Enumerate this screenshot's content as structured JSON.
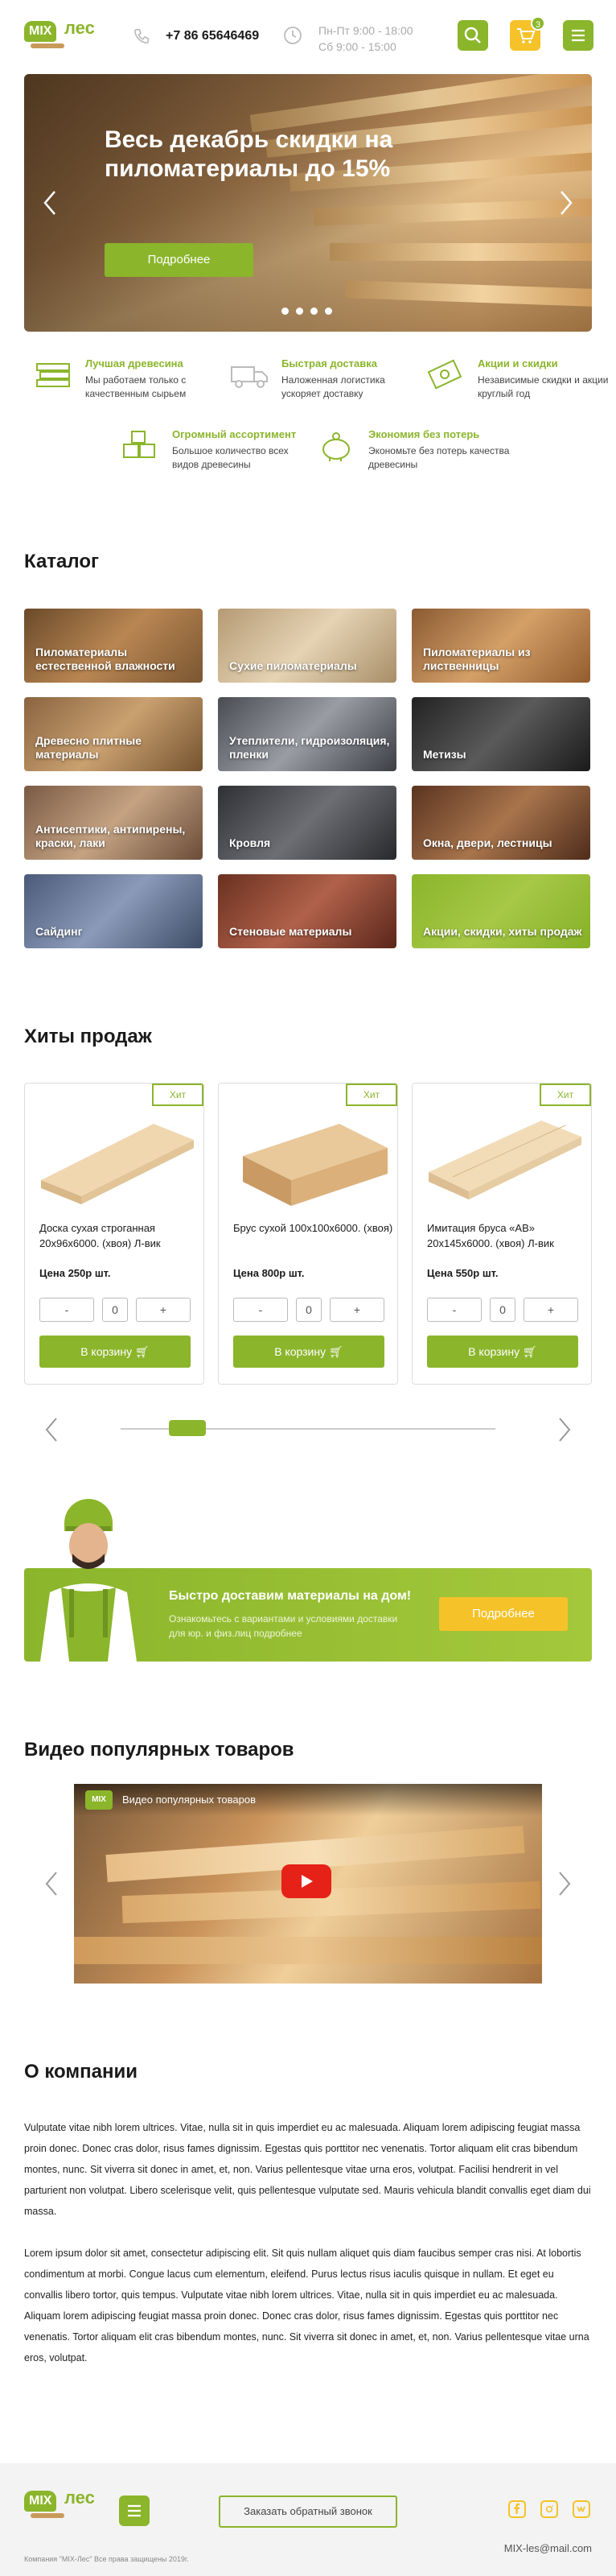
{
  "header": {
    "logo_mix": "MIX",
    "logo_les": "лес",
    "phone": "+7 86 65646469",
    "hours_line1": "Пн-Пт 9:00 - 18:00",
    "hours_line2": "Сб 9:00 - 15:00",
    "cart_count": "3"
  },
  "hero": {
    "title": "Весь декабрь скидки на пиломатериалы до 15%",
    "button": "Подробнее"
  },
  "features": [
    {
      "title": "Лучшая древесина",
      "desc": "Мы работаем только с качественным сырьем",
      "icon": "wood-icon"
    },
    {
      "title": "Быстрая доставка",
      "desc": "Наложенная логистика ускоряет доставку",
      "icon": "truck-icon"
    },
    {
      "title": "Акции и скидки",
      "desc": "Независимые скидки и акции круглый год",
      "icon": "money-icon"
    },
    {
      "title": "Огромный ассортимент",
      "desc": "Большое количество всех видов древесины",
      "icon": "boxes-icon"
    },
    {
      "title": "Экономия без потерь",
      "desc": "Экономьте без потерь качества древесины",
      "icon": "piggy-icon"
    }
  ],
  "catalog": {
    "title": "Каталог",
    "items": [
      "Пиломатериалы естественной влажности",
      "Сухие пиломатериалы",
      "Пиломатериалы из лиственницы",
      "Древесно плитные материалы",
      "Утеплители, гидроизоляция, пленки",
      "Метизы",
      "Антисептики, антипирены, краски, лаки",
      "Кровля",
      "Окна, двери, лестницы",
      "Сайдинг",
      "Стеновые материалы",
      "Акции, скидки, хиты продаж"
    ]
  },
  "hits": {
    "title": "Хиты продаж",
    "badge": "Хит",
    "cart_button": "В корзину",
    "products": [
      {
        "name": "Доска сухая строганная 20х96х6000. (хвоя) Л-вик",
        "price": "Цена 250р шт.",
        "qty": "0"
      },
      {
        "name": "Брус сухой 100х100х6000. (хвоя)",
        "price": "Цена 800р шт.",
        "qty": "0"
      },
      {
        "name": "Имитация бруса «АВ» 20х145х6000. (хвоя) Л-вик",
        "price": "Цена 550р шт.",
        "qty": "0"
      }
    ],
    "minus": "-",
    "plus": "+"
  },
  "delivery": {
    "title": "Быстро доставим материалы на дом!",
    "desc": "Ознакомьтесь с вариантами и условиями доставки для юр. и физ.лиц подробнее",
    "button": "Подробнее"
  },
  "video": {
    "section_title": "Видео популярных товаров",
    "player_title": "Видео популярных товаров",
    "channel_mix": "MIX"
  },
  "about": {
    "title": "О компании",
    "p1": "Vulputate vitae nibh lorem ultrices. Vitae, nulla sit in quis imperdiet eu ac malesuada. Aliquam lorem adipiscing feugiat massa proin donec. Donec cras dolor, risus fames dignissim. Egestas quis porttitor nec venenatis. Tortor aliquam elit cras bibendum montes, nunc. Sit viverra sit donec in amet, et, non. Varius pellentesque vitae urna eros, volutpat. Facilisi hendrerit in vel parturient non volutpat. Libero scelerisque velit, quis pellentesque vulputate sed. Mauris vehicula blandit convallis eget diam dui massa.",
    "p2": "Lorem ipsum dolor sit amet, consectetur adipiscing elit. Sit quis nullam aliquet quis diam faucibus semper cras nisi. At lobortis condimentum at morbi. Congue lacus cum elementum, eleifend. Purus lectus risus iaculis quisque in nullam. Et eget eu convallis libero tortor, quis tempus. Vulputate vitae nibh lorem ultrices. Vitae, nulla sit in quis imperdiet eu ac malesuada. Aliquam lorem adipiscing feugiat massa proin donec. Donec cras dolor, risus fames dignissim. Egestas quis porttitor nec venenatis. Tortor aliquam elit cras bibendum montes, nunc. Sit viverra sit donec in amet, et, non. Varius pellentesque vitae urna eros, volutpat."
  },
  "footer": {
    "callback": "Заказать обратный звонок",
    "copyright": "Компания \"MIX-Лес\" Все права защищены 2019г.",
    "email": "MIX-les@mail.com"
  },
  "colors": {
    "accent": "#8bb52b",
    "yellow": "#f5c229"
  }
}
